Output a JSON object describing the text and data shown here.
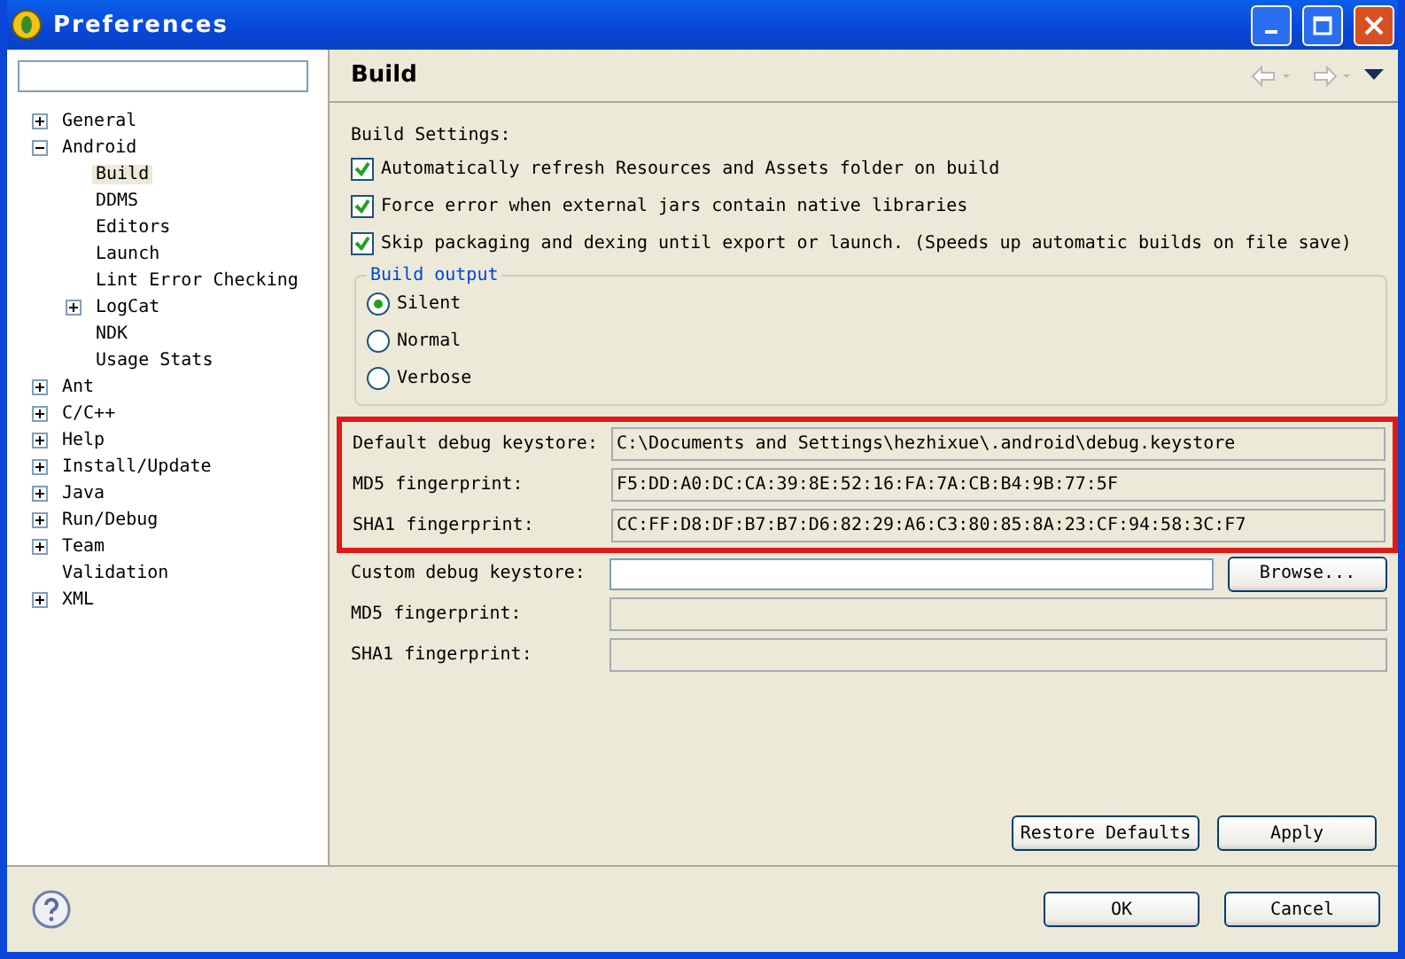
{
  "window": {
    "title": "Preferences"
  },
  "tree": [
    {
      "label": "General",
      "expanded": false,
      "selected": false
    },
    {
      "label": "Android",
      "expanded": true,
      "selected": false,
      "children": [
        {
          "label": "Build",
          "selected": true
        },
        {
          "label": "DDMS",
          "selected": false
        },
        {
          "label": "Editors",
          "selected": false
        },
        {
          "label": "Launch",
          "selected": false
        },
        {
          "label": "Lint Error Checking",
          "selected": false
        },
        {
          "label": "LogCat",
          "expanded": false,
          "selected": false
        },
        {
          "label": "NDK",
          "selected": false
        },
        {
          "label": "Usage Stats",
          "selected": false
        }
      ]
    },
    {
      "label": "Ant",
      "expanded": false,
      "selected": false
    },
    {
      "label": "C/C++",
      "expanded": false,
      "selected": false
    },
    {
      "label": "Help",
      "expanded": false,
      "selected": false
    },
    {
      "label": "Install/Update",
      "expanded": false,
      "selected": false
    },
    {
      "label": "Java",
      "expanded": false,
      "selected": false
    },
    {
      "label": "Run/Debug",
      "expanded": false,
      "selected": false
    },
    {
      "label": "Team",
      "expanded": false,
      "selected": false
    },
    {
      "label": "Validation",
      "selected": false
    },
    {
      "label": "XML",
      "expanded": false,
      "selected": false
    }
  ],
  "page": {
    "title": "Build",
    "section_label": "Build Settings:",
    "checkboxes": [
      {
        "label": "Automatically refresh Resources and Assets folder on build",
        "checked": true
      },
      {
        "label": "Force error when external jars contain native libraries",
        "checked": true
      },
      {
        "label": "Skip packaging and dexing until export or launch. (Speeds up automatic builds on file save)",
        "checked": true
      }
    ],
    "build_output": {
      "title": "Build output",
      "options": [
        {
          "label": "Silent",
          "selected": true
        },
        {
          "label": "Normal",
          "selected": false
        },
        {
          "label": "Verbose",
          "selected": false
        }
      ]
    },
    "default_keystore": {
      "highlighted": true,
      "fields": [
        {
          "label": "Default debug keystore:",
          "value": "C:\\Documents and Settings\\hezhixue\\.android\\debug.keystore"
        },
        {
          "label": "MD5 fingerprint:",
          "value": "F5:DD:A0:DC:CA:39:8E:52:16:FA:7A:CB:B4:9B:77:5F"
        },
        {
          "label": "SHA1 fingerprint:",
          "value": "CC:FF:D8:DF:B7:B7:D6:82:29:A6:C3:80:85:8A:23:CF:94:58:3C:F7"
        }
      ]
    },
    "custom_keystore": {
      "label": "Custom debug keystore:",
      "browse": "Browse..."
    },
    "custom_fields": [
      {
        "label": "MD5 fingerprint:"
      },
      {
        "label": "SHA1 fingerprint:"
      }
    ],
    "buttons": [
      "Restore Defaults",
      "Apply"
    ]
  },
  "dialog_buttons": [
    "OK",
    "Cancel"
  ]
}
